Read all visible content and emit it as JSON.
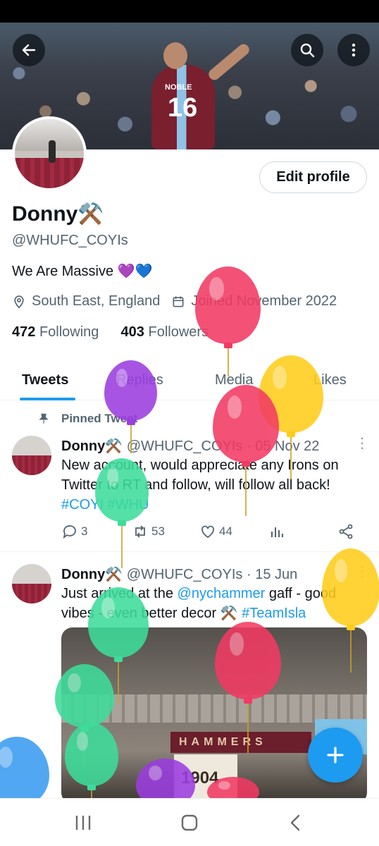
{
  "header": {
    "back_icon": "arrow-left-icon",
    "search_icon": "search-icon",
    "more_icon": "more-vertical-icon",
    "banner_jersey_name": "NOBLE",
    "banner_jersey_number": "16"
  },
  "profile": {
    "edit_label": "Edit profile",
    "name": "Donny",
    "name_emoji": "⚒️",
    "handle": "@WHUFC_COYIs",
    "bio": "We Are Massive 💜💙",
    "location": "South East, England",
    "joined": "Joined November 2022",
    "following_count": "472",
    "following_label": "Following",
    "followers_count": "403",
    "followers_label": "Followers"
  },
  "tabs": [
    {
      "label": "Tweets",
      "active": true
    },
    {
      "label": "Replies",
      "active": false
    },
    {
      "label": "Media",
      "active": false
    },
    {
      "label": "Likes",
      "active": false
    }
  ],
  "pinned_label": "Pinned Tweet",
  "tweets": [
    {
      "name": "Donny⚒️",
      "handle": "@WHUFC_COYIs",
      "date": "· 05 Nov 22",
      "text": "New account, would appreciate any Irons on Twitter to RT and follow, will follow all back!",
      "hashtags": "#COYI #WHU",
      "replies": "3",
      "retweets": "53",
      "likes": "44"
    },
    {
      "name": "Donny⚒️",
      "handle": "@WHUFC_COYIs",
      "date": "· 15 Jun",
      "text_prefix": "Just arrived at the ",
      "mention": "@nychammer",
      "text_mid": " gaff - good vibes - even better decor ⚒️ ",
      "hashtag": "#TeamIsla",
      "media_sign": "HAMMERS",
      "media_box": "1904"
    }
  ],
  "fab_icon": "plus-icon",
  "nav": {
    "recents_icon": "recents-icon",
    "home_icon": "home-icon",
    "back_icon": "nav-back-icon"
  },
  "colors": {
    "accent": "#1d9bf0",
    "text": "#0f1419",
    "secondary": "#536471",
    "balloon_red": "#f23a63",
    "balloon_purple": "#9b3de0",
    "balloon_yellow": "#ffcc1a",
    "balloon_green": "#3ddc9a",
    "balloon_blue": "#3a9bf0"
  }
}
